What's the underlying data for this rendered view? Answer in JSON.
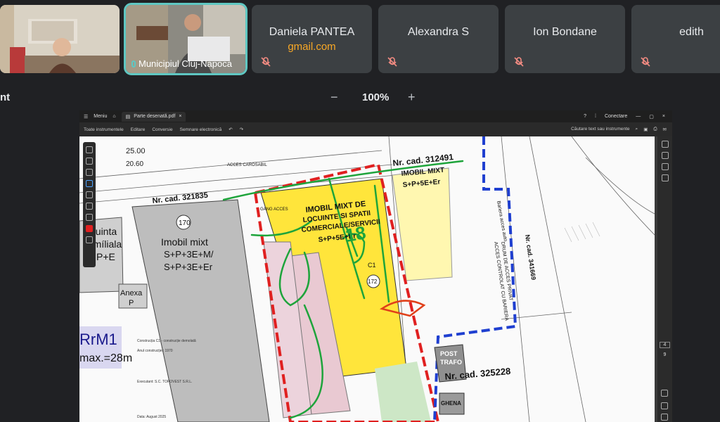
{
  "participants": [
    {
      "name": "",
      "muted": false,
      "type": "video"
    },
    {
      "name": "Municipiul Cluj-Napoca",
      "muted": false,
      "type": "video",
      "active": true
    },
    {
      "name": "Daniela PANTEA",
      "sub": "gmail.com",
      "muted": true
    },
    {
      "name": "Alexandra S",
      "muted": true
    },
    {
      "name": "Ion Bondane",
      "muted": true
    },
    {
      "name": "edith",
      "muted": true
    }
  ],
  "zoom": {
    "left_label": "nt",
    "value": "100%",
    "minus": "−",
    "plus": "+"
  },
  "pdf_app": {
    "menu_label": "Meniu",
    "tab_name": "Parte desenată.pdf",
    "connect": "Conectare",
    "toolbar": [
      "Toate instrumentele",
      "Editare",
      "Conversie",
      "Semnare electronică"
    ],
    "search": "Căutare text sau instrumente"
  },
  "plan": {
    "labels": {
      "d1": "25.00",
      "d2": "20.60",
      "cad1": "Nr. cad. 321835",
      "cad2": "Nr. cad. 312491",
      "cad3": "Nr. cad. 325228",
      "cad4": "Nr. cad. 341669",
      "imobil1_t": "Imobil mixt",
      "imobil1_a": "S+P+3E+M/",
      "imobil1_b": "S+P+3E+Er",
      "imobil1_no": "170",
      "imobil2_t": "IMOBIL MIXT",
      "imobil2_a": "S+P+5E+Er",
      "main1": "IMOBIL MIXT DE",
      "main2": "LOCUINTE SI SPATII",
      "main3": "COMERCIALE/SERVICII",
      "main4": "S+P+5E+Er",
      "c1": "C1",
      "no172": "172",
      "loc1": "ocuinta",
      "loc2": "famíliala",
      "loc3": "P+E",
      "anexa1": "Anexa",
      "anexa2": "P",
      "rm": "RrM1",
      "hmax": "max.=28m",
      "post1": "POST",
      "post2": "TRAFO",
      "ghena": "GHENA",
      "bariera": "Bariera acces auto",
      "drum1": "DRUM DE ACCES PRIVAT",
      "drum2": "ACCES CONTROLAT CU BARIERA",
      "acces": "ACCES CAROSABIL",
      "gang": "GANG ACCES",
      "hw": "18"
    },
    "notes": [
      "Construcția C1 - construcție demolată",
      "Anul construcției: 1970",
      "Executant: S.C. TOPOVEST S.R.L.",
      "Data: August 2025"
    ]
  },
  "page_num": "4",
  "page_total": "9"
}
